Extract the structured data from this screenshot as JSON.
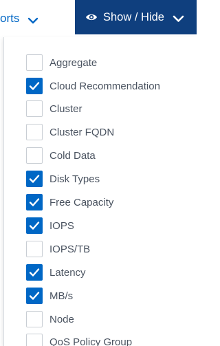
{
  "toolbar": {
    "reports_label": "orts",
    "show_hide_label": "Show / Hide"
  },
  "colors": {
    "accent": "#0067c5",
    "button_bg": "#0f3f7e",
    "text": "#4a5360",
    "checkbox_border": "#c9ced4"
  },
  "columns": [
    {
      "label": "Aggregate",
      "checked": false
    },
    {
      "label": "Cloud Recommendation",
      "checked": true
    },
    {
      "label": "Cluster",
      "checked": false
    },
    {
      "label": "Cluster FQDN",
      "checked": false
    },
    {
      "label": "Cold Data",
      "checked": false
    },
    {
      "label": "Disk Types",
      "checked": true
    },
    {
      "label": "Free Capacity",
      "checked": true
    },
    {
      "label": "IOPS",
      "checked": true
    },
    {
      "label": "IOPS/TB",
      "checked": false
    },
    {
      "label": "Latency",
      "checked": true
    },
    {
      "label": "MB/s",
      "checked": true
    },
    {
      "label": "Node",
      "checked": false
    },
    {
      "label": "QoS Policy Group",
      "checked": false
    }
  ]
}
